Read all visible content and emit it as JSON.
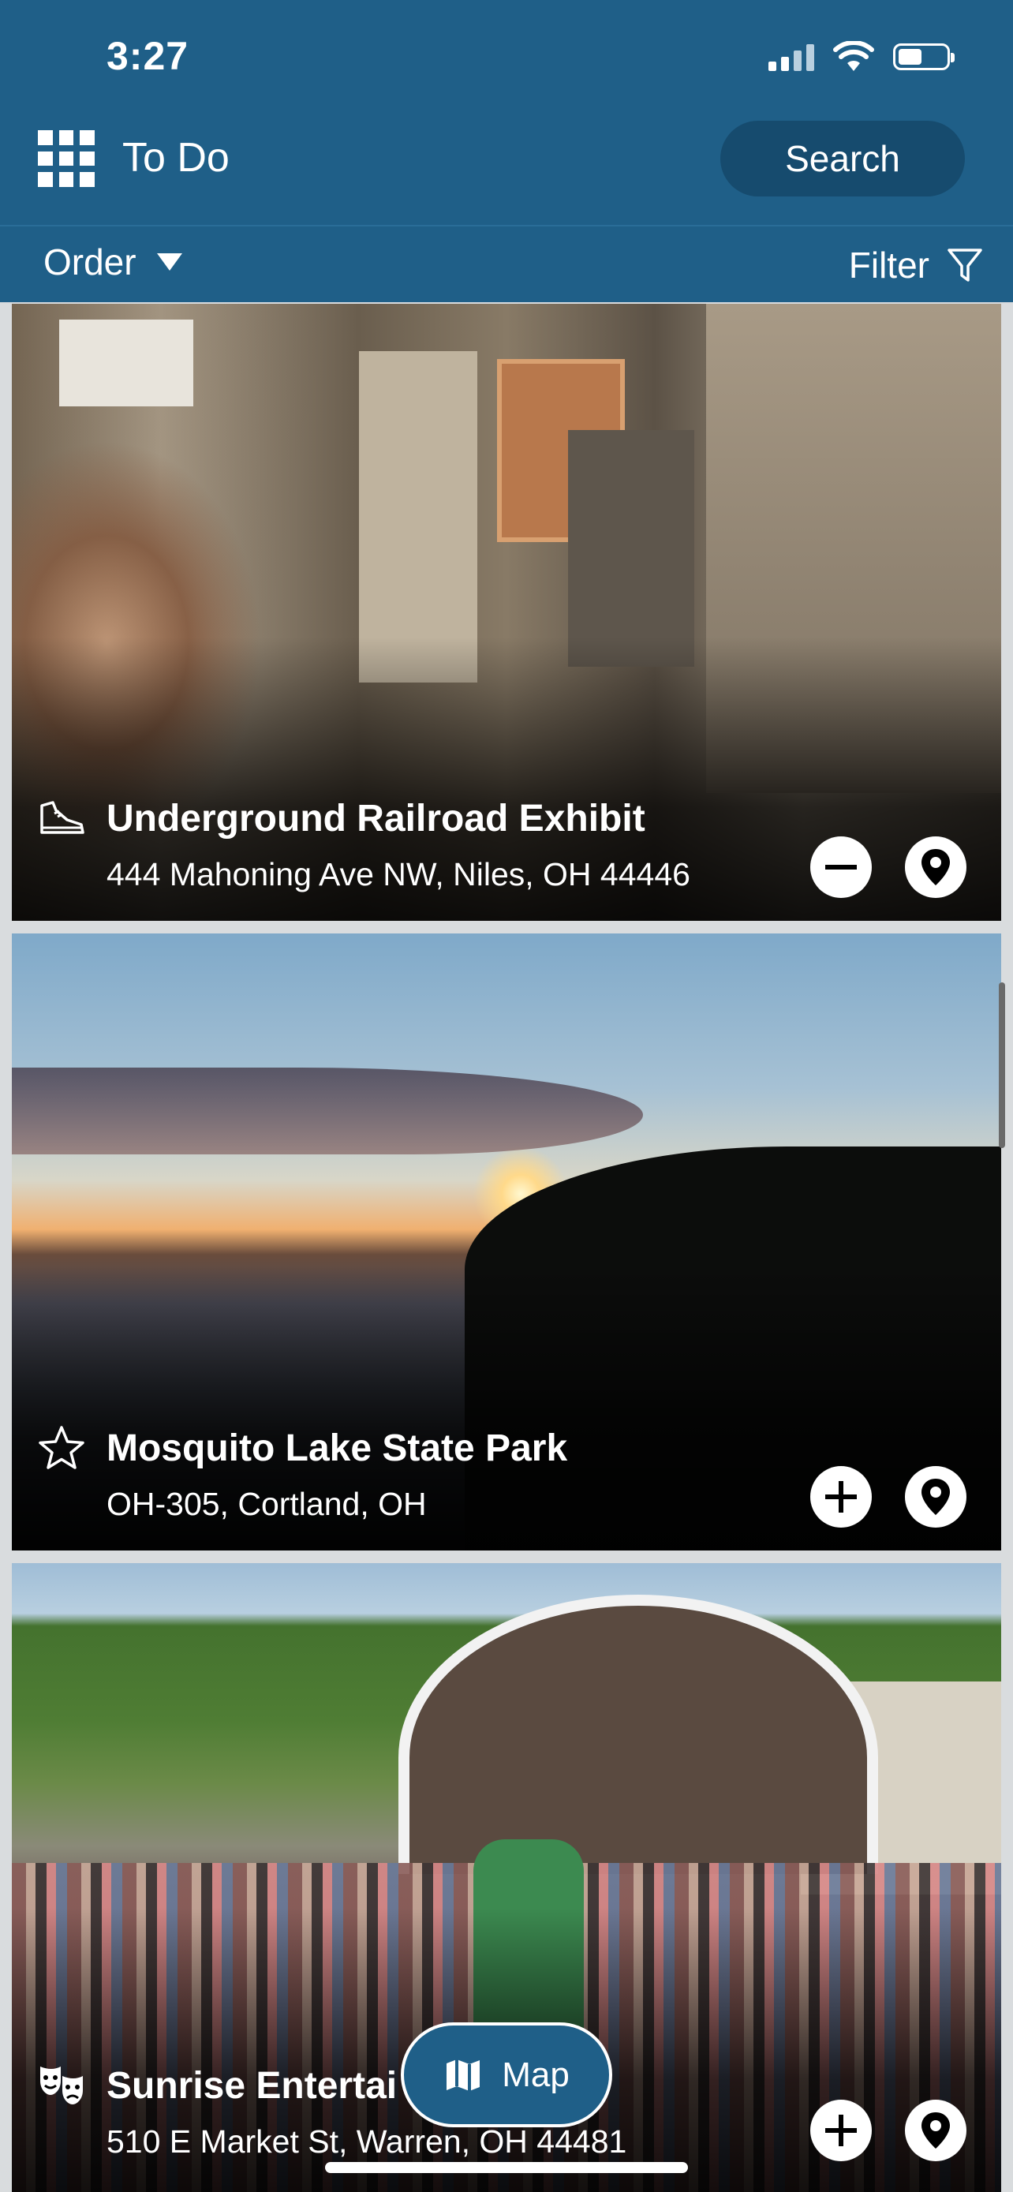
{
  "status_bar": {
    "time": "3:27"
  },
  "header": {
    "title": "To Do",
    "search_label": "Search"
  },
  "subbar": {
    "order_label": "Order",
    "filter_label": "Filter"
  },
  "cards": [
    {
      "title": "Underground Railroad Exhibit",
      "address": "444 Mahoning Ave NW, Niles, OH 44446",
      "category_icon": "sneaker-icon",
      "action": "remove"
    },
    {
      "title": "Mosquito Lake State Park",
      "address": "OH-305, Cortland, OH",
      "category_icon": "star-outline-icon",
      "action": "add"
    },
    {
      "title": "Sunrise Entertai",
      "address": "510 E Market St, Warren, OH 44481",
      "category_icon": "theater-masks-icon",
      "action": "add"
    }
  ],
  "map_button": {
    "label": "Map"
  },
  "colors": {
    "brand": "#1f5f88",
    "brand_dark": "#164b6e"
  }
}
